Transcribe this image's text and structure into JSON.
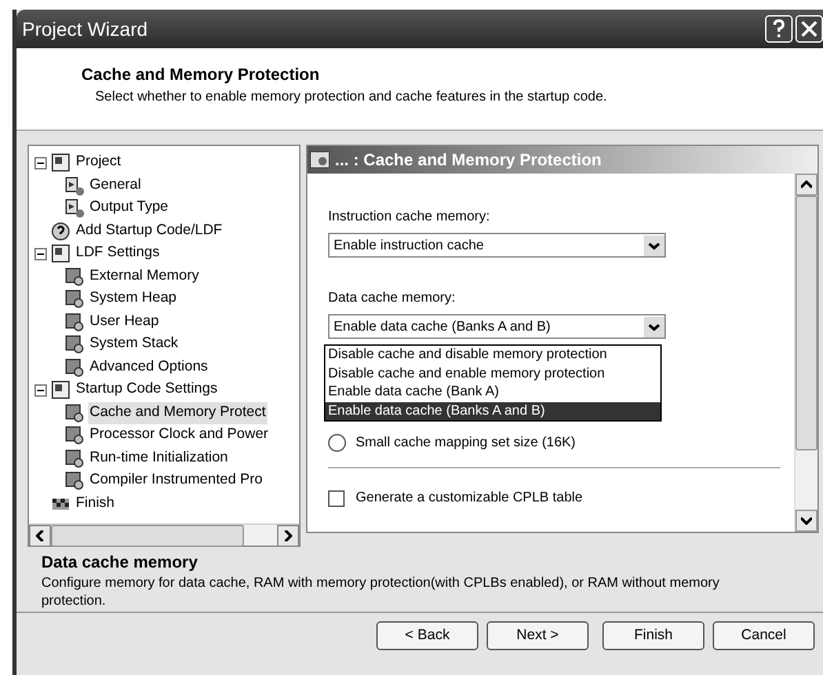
{
  "window": {
    "title": "Project Wizard"
  },
  "header": {
    "title": "Cache and Memory Protection",
    "subtitle": "Select whether to enable memory protection and cache features in the startup code."
  },
  "tree": [
    {
      "label": "Project",
      "kind": "folder",
      "expanded": true,
      "selected": false,
      "children": [
        {
          "label": "General",
          "kind": "page",
          "selected": false
        },
        {
          "label": "Output Type",
          "kind": "page",
          "selected": false
        }
      ]
    },
    {
      "label": "Add Startup Code/LDF",
      "kind": "question",
      "selected": false
    },
    {
      "label": "LDF Settings",
      "kind": "folder",
      "expanded": true,
      "selected": false,
      "children": [
        {
          "label": "External Memory",
          "kind": "setting",
          "selected": false
        },
        {
          "label": "System Heap",
          "kind": "setting",
          "selected": false
        },
        {
          "label": "User Heap",
          "kind": "setting",
          "selected": false
        },
        {
          "label": "System Stack",
          "kind": "setting",
          "selected": false
        },
        {
          "label": "Advanced Options",
          "kind": "setting",
          "selected": false
        }
      ]
    },
    {
      "label": "Startup Code Settings",
      "kind": "folder",
      "expanded": true,
      "selected": false,
      "children": [
        {
          "label": "Cache and Memory Protect",
          "kind": "setting",
          "selected": true
        },
        {
          "label": "Processor Clock and Power",
          "kind": "setting",
          "selected": false
        },
        {
          "label": "Run-time Initialization",
          "kind": "setting",
          "selected": false
        },
        {
          "label": "Compiler Instrumented Pro",
          "kind": "setting",
          "selected": false
        }
      ]
    },
    {
      "label": "Finish",
      "kind": "finish",
      "selected": false
    }
  ],
  "panel": {
    "title": "... : Cache and Memory Protection",
    "instruction_cache": {
      "label": "Instruction cache memory:",
      "value": "Enable instruction cache"
    },
    "data_cache": {
      "label": "Data cache memory:",
      "value": "Enable data cache (Banks A and B)",
      "options": [
        {
          "label": "Disable cache and disable memory protection",
          "selected": false
        },
        {
          "label": "Disable cache and enable memory protection",
          "selected": false
        },
        {
          "label": "Enable data cache (Bank A)",
          "selected": false
        },
        {
          "label": "Enable data cache (Banks A and B)",
          "selected": true
        }
      ]
    },
    "radio": {
      "label": "Small cache mapping set size (16K)",
      "checked": false
    },
    "checkbox": {
      "label": "Generate a customizable CPLB table",
      "checked": false
    }
  },
  "info": {
    "title": "Data cache memory",
    "text": "Configure memory for data cache, RAM with memory protection(with CPLBs enabled), or RAM without memory protection."
  },
  "buttons": [
    "< Back",
    "Next >",
    "Finish",
    "Cancel"
  ]
}
